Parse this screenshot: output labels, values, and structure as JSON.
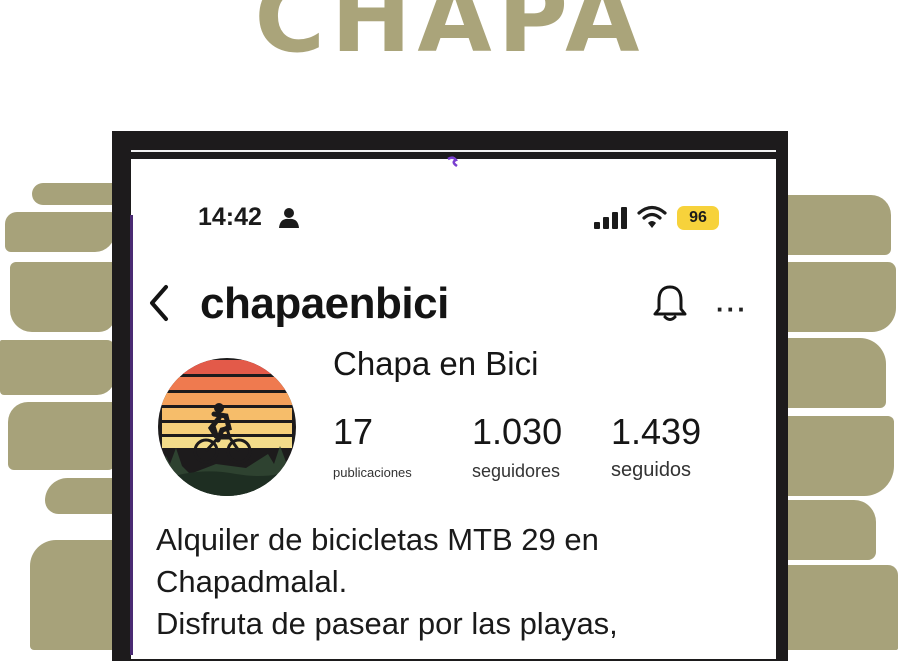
{
  "banner": {
    "title": "CHAPA"
  },
  "status_bar": {
    "time": "14:42",
    "battery": "96",
    "person_icon": "person-icon",
    "signal_icon": "signal-icon",
    "wifi_icon": "wifi-icon"
  },
  "profile_header": {
    "username": "chapaenbici",
    "back_icon": "chevron-left-icon",
    "bell_icon": "bell-icon",
    "more_icon": "more-icon",
    "more_glyph": "···"
  },
  "profile": {
    "display_name": "Chapa en Bici",
    "stats": [
      {
        "value": "17",
        "label": "publicaciones"
      },
      {
        "value": "1.030",
        "label": "seguidores"
      },
      {
        "value": "1.439",
        "label": "seguidos"
      }
    ],
    "bio_lines": [
      "Alquiler de bicicletas MTB 29 en",
      "Chapadmalal.",
      "Disfruta de pasear por las playas,"
    ]
  },
  "colors": {
    "accent_olive": "#a7a27a",
    "frame_dark": "#1d1b1c",
    "battery_yellow": "#f7d23b",
    "text_dark": "#161616"
  }
}
